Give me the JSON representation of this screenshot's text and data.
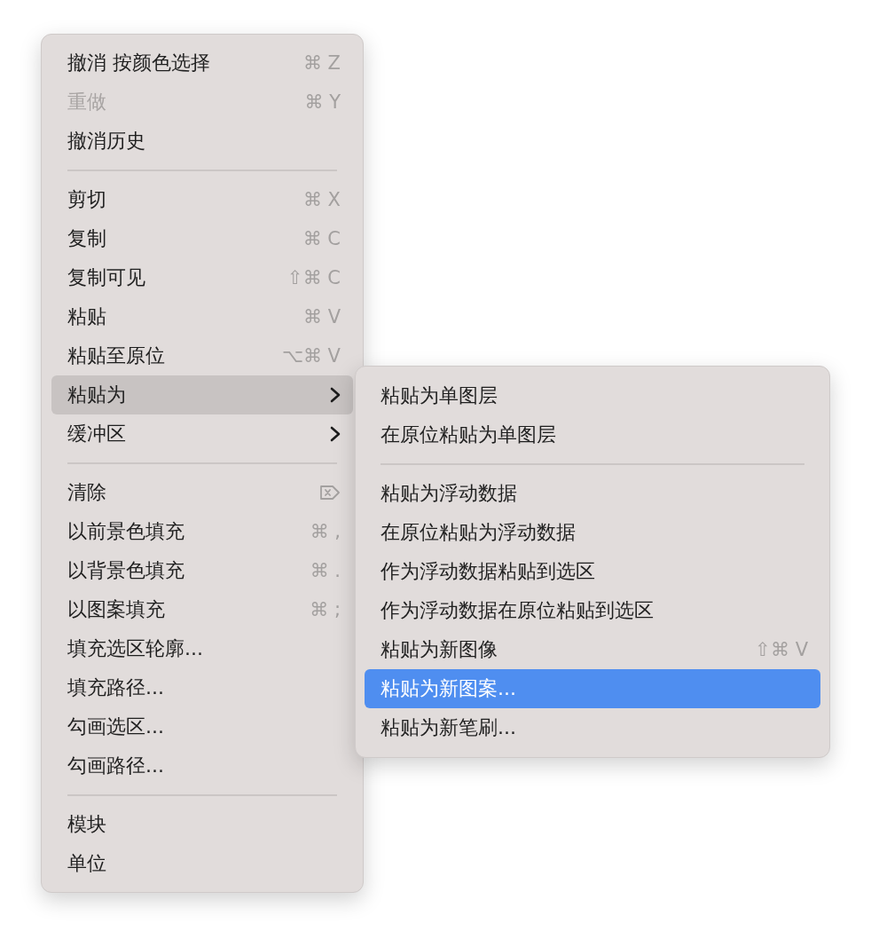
{
  "menu": {
    "items": [
      {
        "kind": "command",
        "label": "撤消 按颜色选择",
        "shortcut": "⌘ Z",
        "disabled": false,
        "selected": false
      },
      {
        "kind": "command",
        "label": "重做",
        "shortcut": "⌘ Y",
        "disabled": true,
        "selected": false
      },
      {
        "kind": "command",
        "label": "撤消历史",
        "disabled": false,
        "selected": false
      },
      {
        "kind": "separator"
      },
      {
        "kind": "command",
        "label": "剪切",
        "shortcut": "⌘ X",
        "disabled": false,
        "selected": false
      },
      {
        "kind": "command",
        "label": "复制",
        "shortcut": "⌘ C",
        "disabled": false,
        "selected": false
      },
      {
        "kind": "command",
        "label": "复制可见",
        "shortcut": "⇧⌘ C",
        "disabled": false,
        "selected": false
      },
      {
        "kind": "command",
        "label": "粘贴",
        "shortcut": "⌘ V",
        "disabled": false,
        "selected": false
      },
      {
        "kind": "command",
        "label": "粘贴至原位",
        "shortcut": "⌥⌘ V",
        "disabled": false,
        "selected": false
      },
      {
        "kind": "submenu",
        "label": "粘贴为",
        "disabled": false,
        "selected": true
      },
      {
        "kind": "submenu",
        "label": "缓冲区",
        "disabled": false,
        "selected": false
      },
      {
        "kind": "separator"
      },
      {
        "kind": "delete-key",
        "label": "清除",
        "disabled": false,
        "selected": false
      },
      {
        "kind": "command",
        "label": "以前景色填充",
        "shortcut": "⌘ ,",
        "disabled": false,
        "selected": false
      },
      {
        "kind": "command",
        "label": "以背景色填充",
        "shortcut": "⌘ .",
        "disabled": false,
        "selected": false
      },
      {
        "kind": "command",
        "label": "以图案填充",
        "shortcut": "⌘ ;",
        "disabled": false,
        "selected": false
      },
      {
        "kind": "command",
        "label": "填充选区轮廓...",
        "disabled": false,
        "selected": false
      },
      {
        "kind": "command",
        "label": "填充路径...",
        "disabled": false,
        "selected": false
      },
      {
        "kind": "command",
        "label": "勾画选区...",
        "disabled": false,
        "selected": false
      },
      {
        "kind": "command",
        "label": "勾画路径...",
        "disabled": false,
        "selected": false
      },
      {
        "kind": "separator"
      },
      {
        "kind": "command",
        "label": "模块",
        "disabled": false,
        "selected": false
      },
      {
        "kind": "command",
        "label": "单位",
        "disabled": false,
        "selected": false
      }
    ]
  },
  "submenu": {
    "items": [
      {
        "kind": "command",
        "label": "粘贴为单图层",
        "disabled": false,
        "selected": false
      },
      {
        "kind": "command",
        "label": "在原位粘贴为单图层",
        "disabled": false,
        "selected": false
      },
      {
        "kind": "separator"
      },
      {
        "kind": "command",
        "label": "粘贴为浮动数据",
        "disabled": false,
        "selected": false
      },
      {
        "kind": "command",
        "label": "在原位粘贴为浮动数据",
        "disabled": false,
        "selected": false
      },
      {
        "kind": "command",
        "label": "作为浮动数据粘贴到选区",
        "disabled": false,
        "selected": false
      },
      {
        "kind": "command",
        "label": "作为浮动数据在原位粘贴到选区",
        "disabled": false,
        "selected": false
      },
      {
        "kind": "command",
        "label": "粘贴为新图像",
        "shortcut": "⇧⌘ V",
        "disabled": false,
        "selected": false
      },
      {
        "kind": "command",
        "label": "粘贴为新图案...",
        "disabled": false,
        "selected": true
      },
      {
        "kind": "command",
        "label": "粘贴为新笔刷...",
        "disabled": false,
        "selected": false
      }
    ]
  }
}
